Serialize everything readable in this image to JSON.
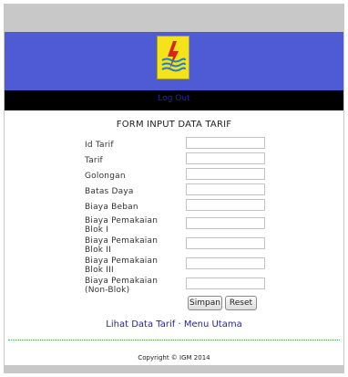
{
  "nav": {
    "logout_label": "Log Out"
  },
  "form": {
    "title": "FORM INPUT DATA TARIF",
    "fields": [
      {
        "label": "Id Tarif",
        "value": ""
      },
      {
        "label": "Tarif",
        "value": ""
      },
      {
        "label": "Golongan",
        "value": ""
      },
      {
        "label": "Batas Daya",
        "value": ""
      },
      {
        "label": "Biaya Beban",
        "value": ""
      },
      {
        "label": "Biaya Pemakaian Blok I",
        "value": ""
      },
      {
        "label": "Biaya Pemakaian Blok II",
        "value": ""
      },
      {
        "label": "Biaya Pemakaian Blok III",
        "value": ""
      },
      {
        "label": "Biaya Pemakaian (Non-Blok)",
        "value": ""
      }
    ],
    "submit_label": "Simpan",
    "reset_label": "Reset"
  },
  "links": {
    "view_data": "Lihat Data Tarif",
    "separator": "·",
    "main_menu": "Menu Utama"
  },
  "footer": {
    "copyright": "Copyright © IGM 2014"
  },
  "colors": {
    "banner": "#4f5bd5",
    "navbar": "#000000",
    "logo": "#f4e21a",
    "link": "#2525a0"
  }
}
